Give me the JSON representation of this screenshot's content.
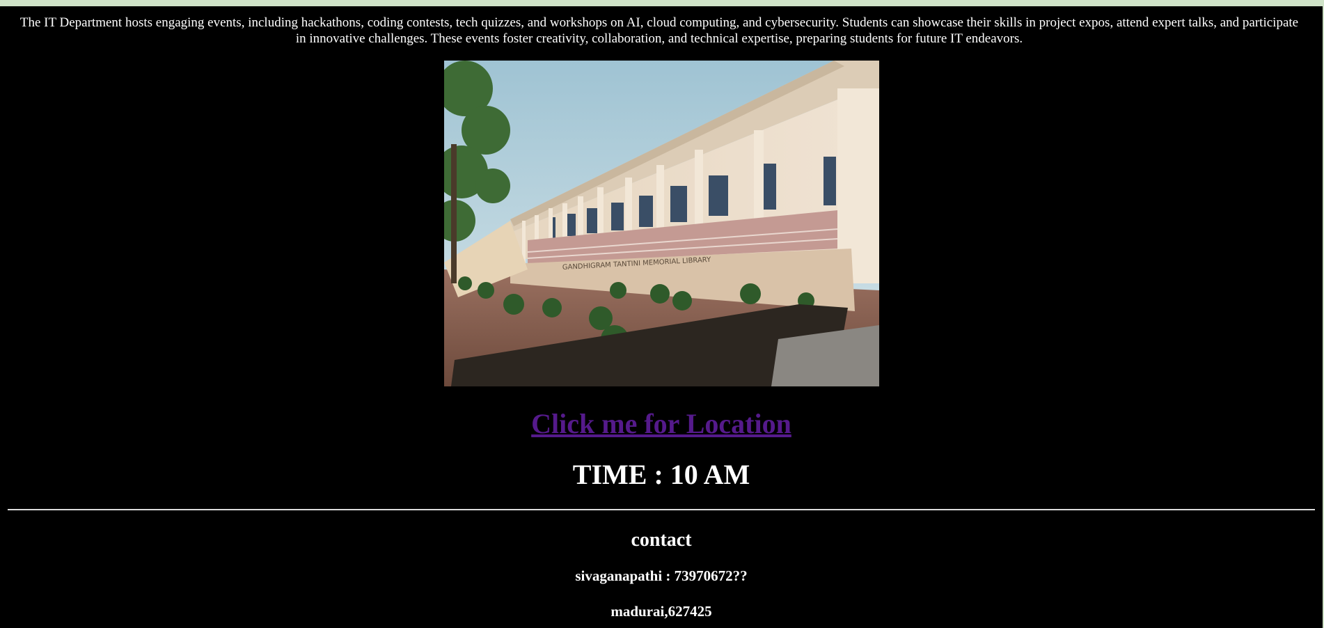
{
  "intro_text": "The IT Department hosts engaging events, including hackathons, coding contests, tech quizzes, and workshops on AI, cloud computing, and cybersecurity. Students can showcase their skills in project expos, attend expert talks, and participate in innovative challenges. These events foster creativity, collaboration, and technical expertise, preparing students for future IT endeavors.",
  "photo": {
    "sign_text": "GANDHIGRAM TANTINI MEMORIAL LIBRARY"
  },
  "location_link_label": "Click me for Location",
  "time_text": "TIME : 10 AM",
  "contact": {
    "heading": "contact",
    "phone_line": "sivaganapathi : 73970672??",
    "address_line": "madurai,627425"
  },
  "colors": {
    "page_background": "#000000",
    "top_strip": "#cfe3c8",
    "visited_link": "#551a8b",
    "text": "#ffffff"
  }
}
